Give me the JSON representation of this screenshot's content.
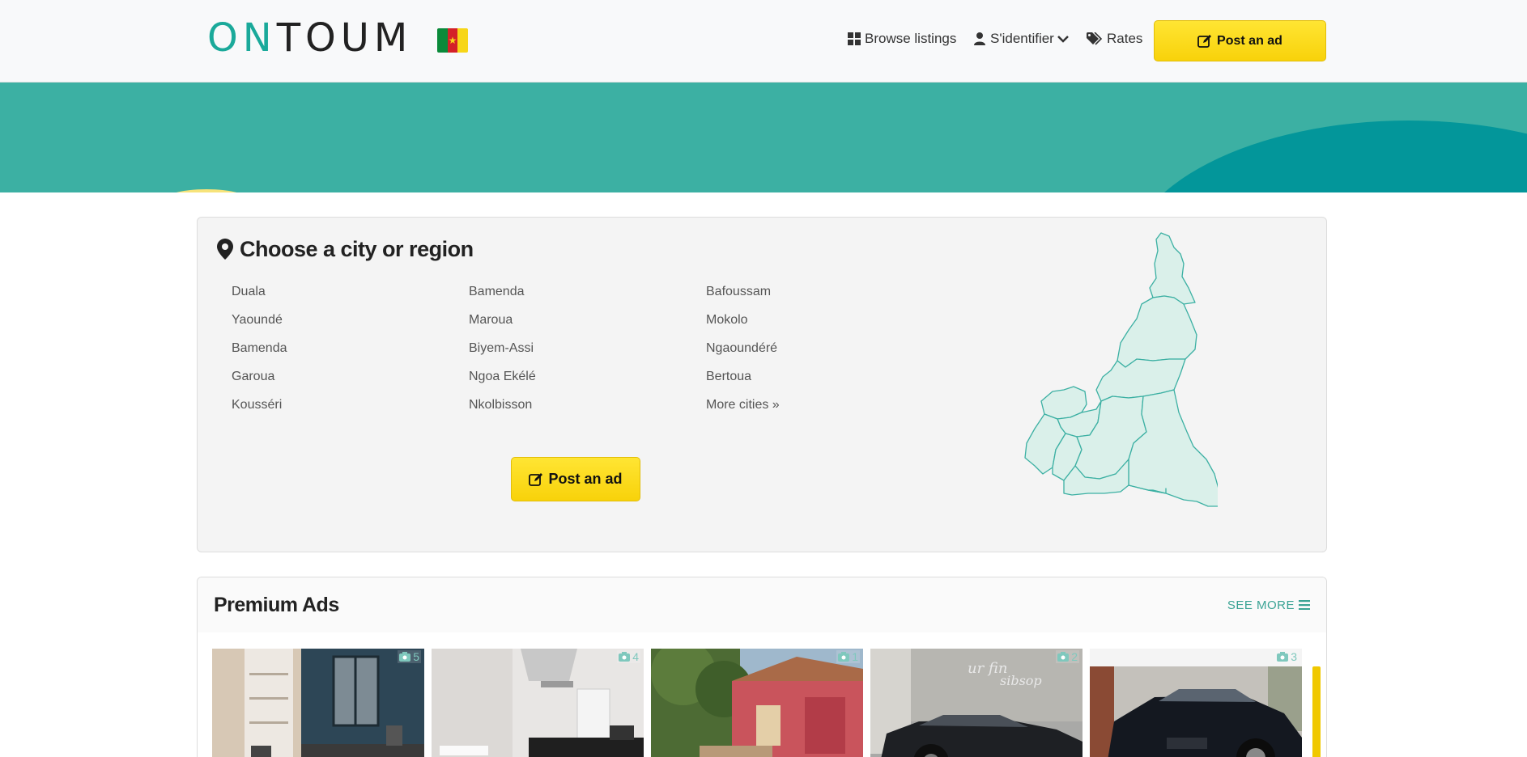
{
  "header": {
    "logo_accent": "ON",
    "logo_rest": "TOUM",
    "nav_browse": "Browse listings",
    "nav_login": "S'identifier",
    "nav_rates": "Rates",
    "post_ad": "Post an ad"
  },
  "cities_panel": {
    "title": "Choose a city or region",
    "columns": [
      [
        "Duala",
        "Yaoundé",
        "Bamenda",
        "Garoua",
        "Kousséri"
      ],
      [
        "Bamenda",
        "Maroua",
        "Biyem-Assi",
        "Ngoa Ekélé",
        "Nkolbisson"
      ],
      [
        "Bafoussam",
        "Mokolo",
        "Ngaoundéré",
        "Bertoua",
        "More cities »"
      ]
    ],
    "post_ad": "Post an ad"
  },
  "premium": {
    "title": "Premium Ads",
    "see_more": "SEE MORE",
    "ads": [
      {
        "photos": "5"
      },
      {
        "photos": "4"
      },
      {
        "photos": "1"
      },
      {
        "photos": "2"
      },
      {
        "photos": "3"
      }
    ]
  },
  "colors": {
    "brand_teal": "#1aa99a",
    "banner": "#3cb0a3",
    "cta_yellow": "#ffe533"
  }
}
